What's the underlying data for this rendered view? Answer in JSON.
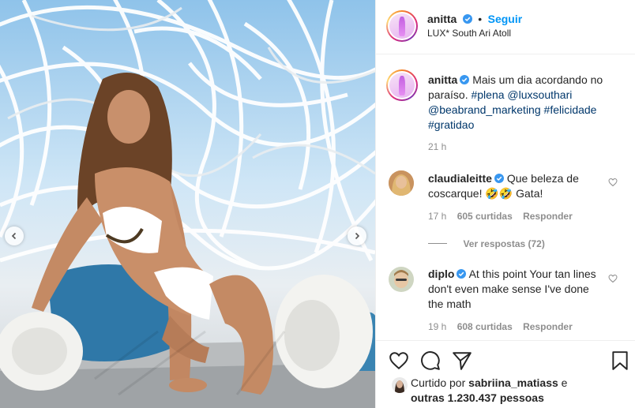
{
  "post": {
    "username": "anitta",
    "follow_label": "Seguir",
    "location": "LUX* South Ari Atoll",
    "separator": "•"
  },
  "caption": {
    "username": "anitta",
    "text_before": "Mais um dia acordando no paraíso.",
    "tags": [
      "#plena",
      "@luxsouthari",
      "@beabrand_marketing",
      "#felicidade",
      "#gratidao"
    ],
    "time": "21 h"
  },
  "comments": [
    {
      "username": "claudialeitte",
      "text": "Que beleza de coscarque! 🤣🤣 Gata!",
      "time": "17 h",
      "likes": "605 curtidas",
      "reply_label": "Responder",
      "view_replies": "Ver respostas (72)"
    },
    {
      "username": "diplo",
      "text": "At this point Your tan lines don't even make sense I've done the math",
      "time": "19 h",
      "likes": "608 curtidas",
      "reply_label": "Responder"
    }
  ],
  "likes_summary": {
    "prefix": "Curtido por",
    "liker": "sabriina_matiass",
    "connector": "e",
    "others": "outras 1.230.437 pessoas"
  },
  "icons": {
    "verified": "verified-badge-icon",
    "like": "heart-icon",
    "comment": "comment-bubble-icon",
    "share": "paper-plane-icon",
    "save": "bookmark-icon",
    "prev": "chevron-left-icon",
    "next": "chevron-right-icon"
  },
  "colors": {
    "link_blue": "#0095f6",
    "verified_blue": "#3897f0",
    "tag_blue": "#00376b",
    "muted": "#8e8e8e",
    "text": "#262626"
  }
}
